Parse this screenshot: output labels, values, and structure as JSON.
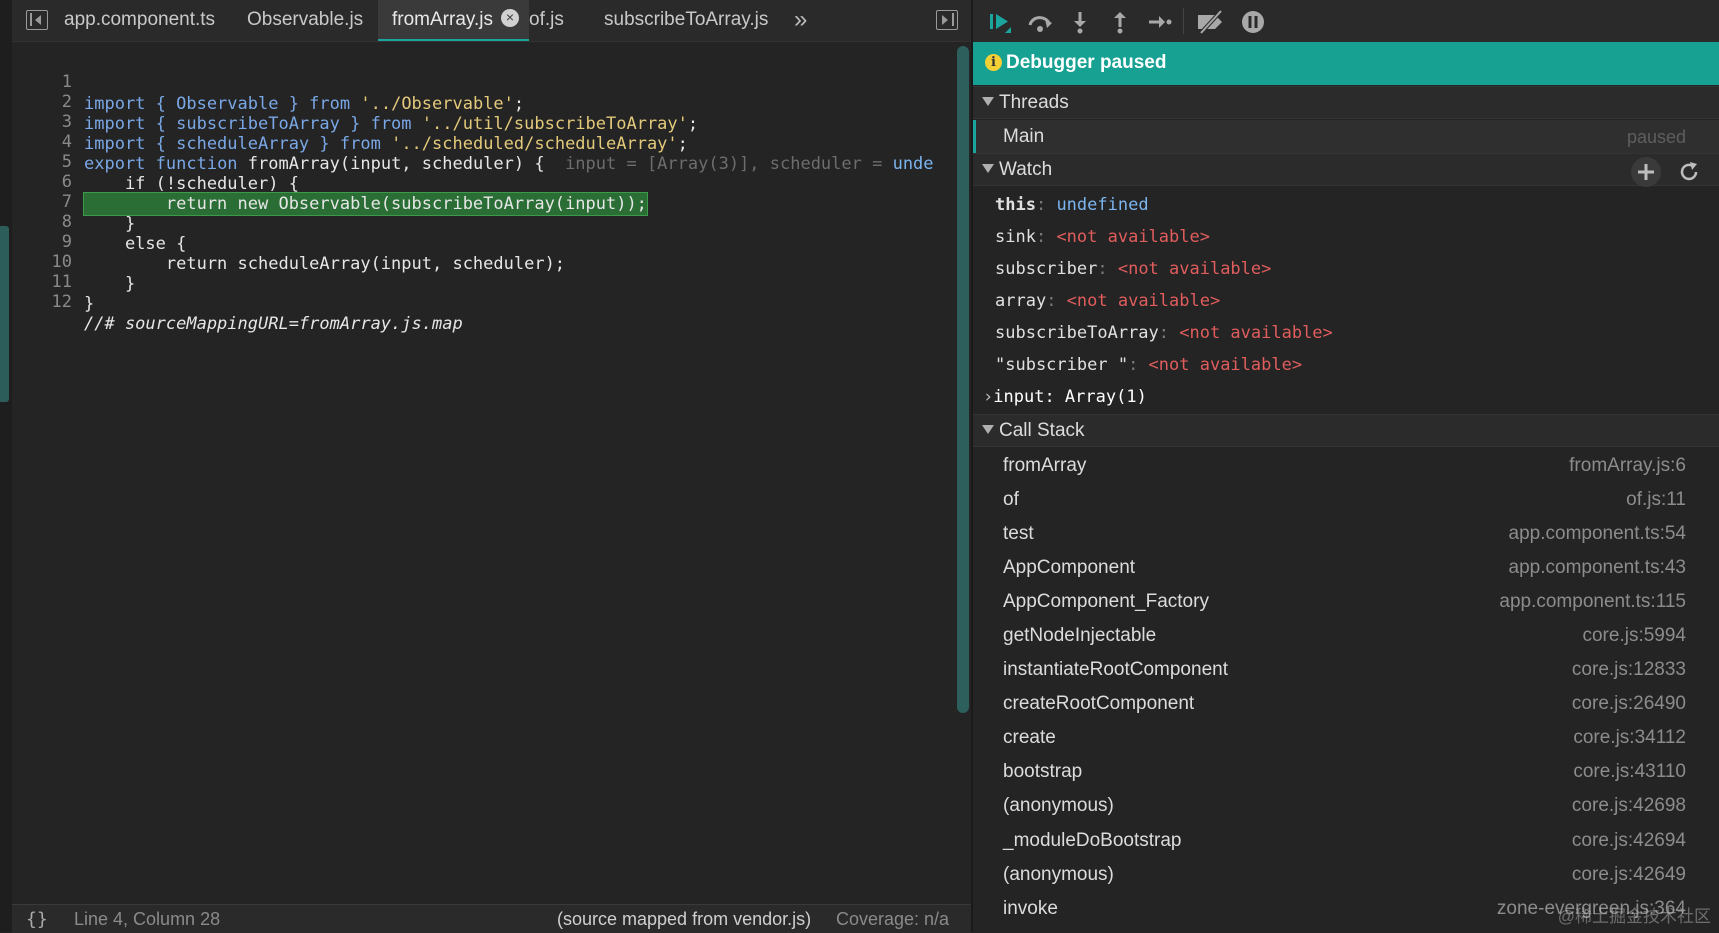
{
  "editor": {
    "tabs": [
      {
        "label": "app.component.ts"
      },
      {
        "label": "Observable.js"
      },
      {
        "label": "fromArray.js",
        "close": "×"
      },
      {
        "label": "of.js"
      },
      {
        "label": "subscribeToArray.js"
      }
    ],
    "more_tabs_glyph": "»",
    "lines": [
      {
        "n": "1"
      },
      {
        "n": "2"
      },
      {
        "n": "3"
      },
      {
        "n": "4"
      },
      {
        "n": "5"
      },
      {
        "n": "6"
      },
      {
        "n": "7"
      },
      {
        "n": "8"
      },
      {
        "n": "9"
      },
      {
        "n": "10"
      },
      {
        "n": "11"
      },
      {
        "n": "12"
      }
    ],
    "code": {
      "l1": {
        "a": "import { Observable } ",
        "b": "from",
        "c": " ",
        "d": "'../Observable'",
        "e": ";"
      },
      "l2": {
        "a": "import { subscribeToArray } ",
        "b": "from",
        "c": " ",
        "d": "'../util/subscribeToArray'",
        "e": ";"
      },
      "l3": {
        "a": "import { scheduleArray } ",
        "b": "from",
        "c": " ",
        "d": "'../scheduled/scheduleArray'",
        "e": ";"
      },
      "l4": {
        "a": "export ",
        "b": "function",
        "c": " fromArray(input, scheduler) {  ",
        "d": "input = [Array(3)], scheduler = ",
        "e": "unde"
      },
      "l5": {
        "a": "    if (!scheduler) {"
      },
      "l6": {
        "a": "        return new Observable(subscribeToArray(input));"
      },
      "l7": {
        "a": "    }"
      },
      "l8": {
        "a": "    else {"
      },
      "l9": {
        "a": "        return scheduleArray(input, scheduler);"
      },
      "l10": {
        "a": "    }"
      },
      "l11": {
        "a": "}"
      },
      "l12": {
        "a": "//# sourceMappingURL=fromArray.js.map"
      }
    },
    "status": {
      "braces": "{}",
      "position": "Line 4, Column 28",
      "source": "(source mapped from vendor.js)",
      "coverage": "Coverage: n/a"
    }
  },
  "debugger": {
    "banner": "Debugger paused",
    "threads_header": "Threads",
    "thread": {
      "name": "Main",
      "state": "paused"
    },
    "watch_header": "Watch",
    "watch": {
      "w1": {
        "key": "this",
        "value": "undefined"
      },
      "w2": {
        "key": "sink",
        "value": "<not available>"
      },
      "w3": {
        "key": "subscriber",
        "value": "<not available>"
      },
      "w4": {
        "key": "array",
        "value": "<not available>"
      },
      "w5": {
        "key": "subscribeToArray",
        "value": "<not available>"
      },
      "w6": {
        "key": "\"subscriber \"",
        "value": "<not available>"
      },
      "w7": {
        "key": "input",
        "value": "Array(1)"
      }
    },
    "callstack_header": "Call Stack",
    "frames": [
      {
        "name": "fromArray",
        "loc": "fromArray.js:6"
      },
      {
        "name": "of",
        "loc": "of.js:11"
      },
      {
        "name": "test",
        "loc": "app.component.ts:54"
      },
      {
        "name": "AppComponent",
        "loc": "app.component.ts:43"
      },
      {
        "name": "AppComponent_Factory",
        "loc": "app.component.ts:115"
      },
      {
        "name": "getNodeInjectable",
        "loc": "core.js:5994"
      },
      {
        "name": "instantiateRootComponent",
        "loc": "core.js:12833"
      },
      {
        "name": "createRootComponent",
        "loc": "core.js:26490"
      },
      {
        "name": "create",
        "loc": "core.js:34112"
      },
      {
        "name": "bootstrap",
        "loc": "core.js:43110"
      },
      {
        "name": "(anonymous)",
        "loc": "core.js:42698"
      },
      {
        "name": "_moduleDoBootstrap",
        "loc": "core.js:42694"
      },
      {
        "name": "(anonymous)",
        "loc": "core.js:42649"
      },
      {
        "name": "invoke",
        "loc": "zone-evergreen.js:364"
      }
    ]
  },
  "watermark": "@稀土掘金技术社区",
  "colors": {
    "accent": "#16a193",
    "highlight_line": "#2a6e35",
    "not_available": "#e05d5d",
    "undefined": "#7bb5ef"
  }
}
